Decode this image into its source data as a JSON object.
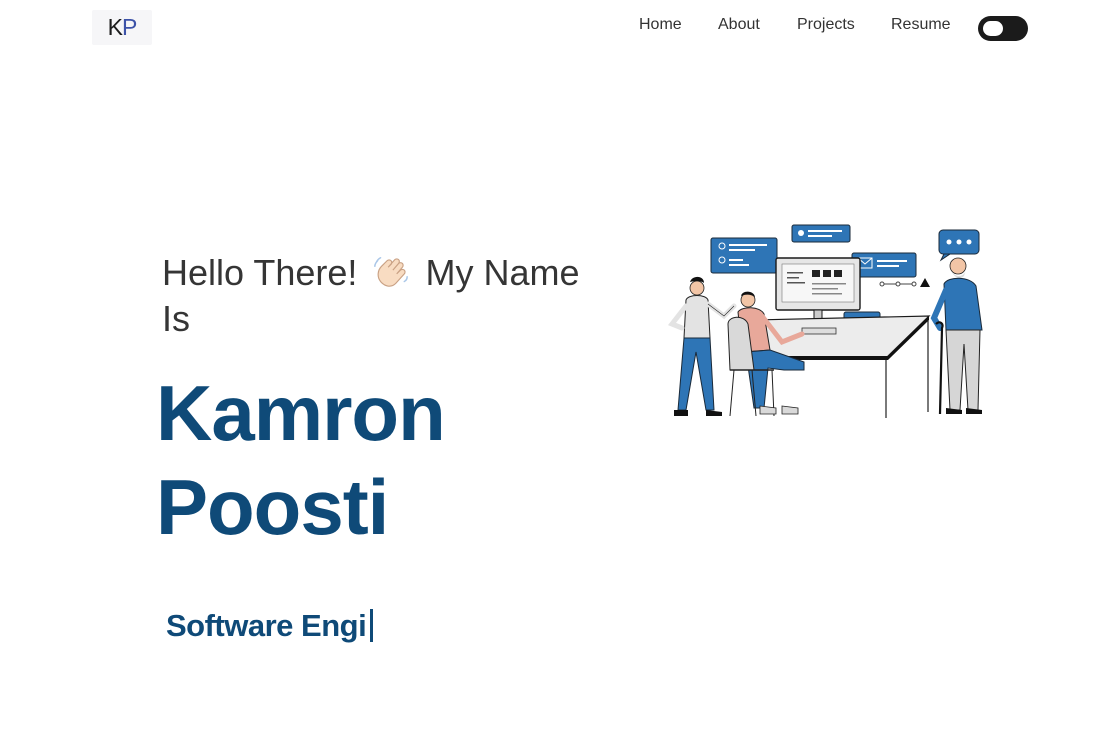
{
  "logo": {
    "k": "K",
    "p": "P"
  },
  "nav": {
    "home": "Home",
    "about": "About",
    "projects": "Projects",
    "resume": "Resume"
  },
  "hero": {
    "greeting_prefix": "Hello There!",
    "wave_icon": "waving-hand-emoji",
    "greeting_suffix": "My Name Is",
    "first_name": "Kamron",
    "last_name": "Poosti",
    "typed_text": "Software Engi"
  },
  "colors": {
    "accent": "#0f4a78",
    "illustration_blue": "#2e75b6",
    "toggle_bg": "#1b1b1b"
  }
}
